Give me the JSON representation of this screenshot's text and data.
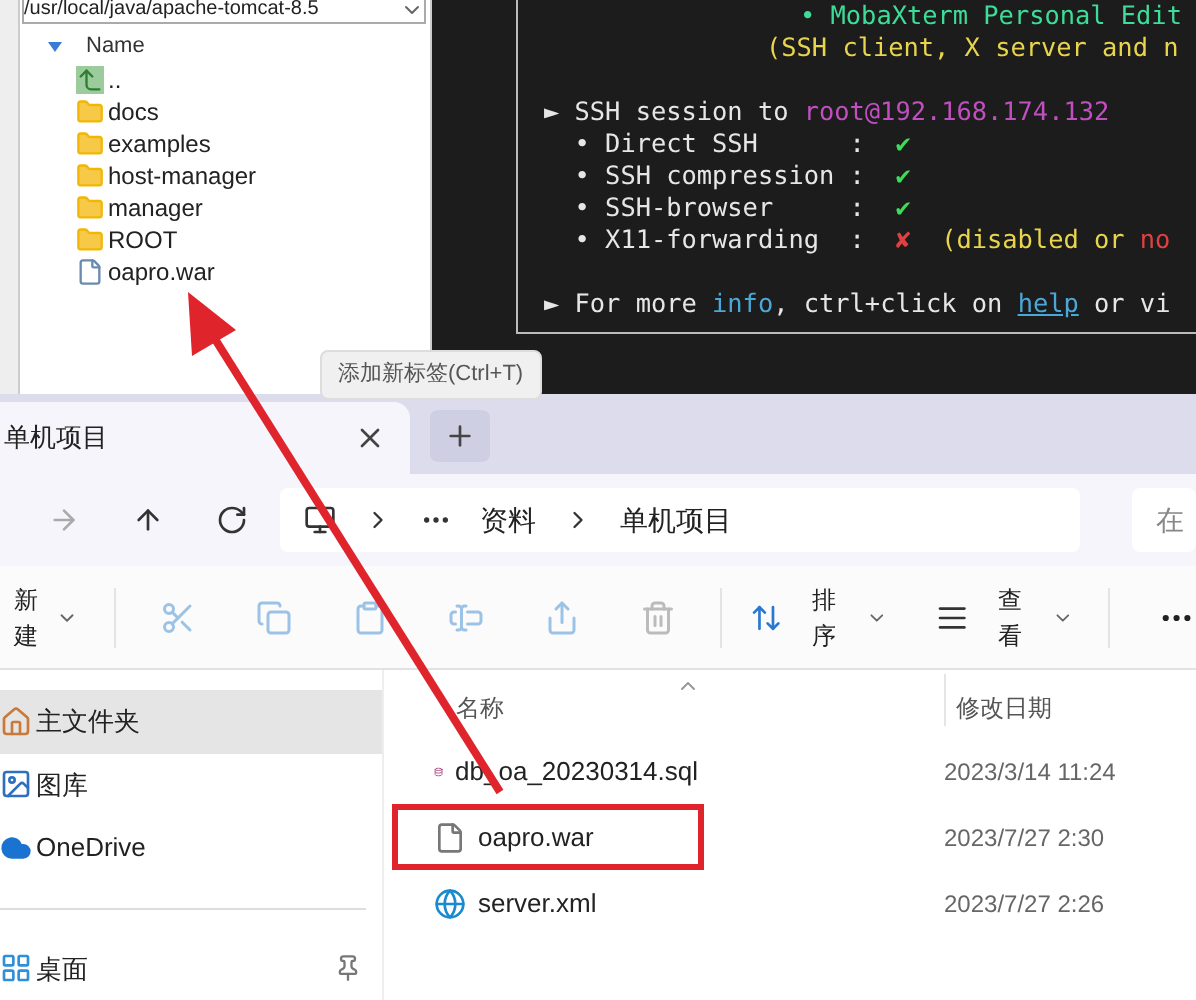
{
  "sftp_browser": {
    "path": "/usr/local/java/apache-tomcat-8.5",
    "column": "Name",
    "items": [
      {
        "kind": "up",
        "name": ".."
      },
      {
        "kind": "folder",
        "name": "docs"
      },
      {
        "kind": "folder",
        "name": "examples"
      },
      {
        "kind": "folder",
        "name": "host-manager"
      },
      {
        "kind": "folder",
        "name": "manager"
      },
      {
        "kind": "folder",
        "name": "ROOT"
      },
      {
        "kind": "file",
        "name": "oapro.war"
      }
    ]
  },
  "terminal": {
    "lines": [
      {
        "segments": [
          {
            "text": "• MobaXterm Personal Edit",
            "color": "#3ddc97"
          }
        ]
      },
      {
        "segments": [
          {
            "text": "(SSH client, X server and n",
            "color": "#e8d44d"
          }
        ]
      },
      {
        "segments": [
          {
            "text": "► SSH session to ",
            "color": "#e6e6e6"
          },
          {
            "text": "root@192.168.174.132",
            "color": "#c04fc0"
          }
        ]
      },
      {
        "segments": [
          {
            "text": "  • Direct SSH      :  ",
            "color": "#e6e6e6"
          },
          {
            "text": "✔",
            "color": "#3ddc5a"
          }
        ]
      },
      {
        "segments": [
          {
            "text": "  • SSH compression :  ",
            "color": "#e6e6e6"
          },
          {
            "text": "✔",
            "color": "#3ddc5a"
          }
        ]
      },
      {
        "segments": [
          {
            "text": "  • SSH-browser     :  ",
            "color": "#e6e6e6"
          },
          {
            "text": "✔",
            "color": "#3ddc5a"
          }
        ]
      },
      {
        "segments": [
          {
            "text": "  • X11-forwarding  :  ",
            "color": "#e6e6e6"
          },
          {
            "text": "✘",
            "color": "#e04040"
          },
          {
            "text": "  (disabled or ",
            "color": "#e8d44d"
          },
          {
            "text": "no",
            "color": "#e04040"
          }
        ]
      },
      {
        "segments": [
          {
            "text": "► For more ",
            "color": "#e6e6e6"
          },
          {
            "text": "info",
            "color": "#4aa8d8"
          },
          {
            "text": ", ctrl+click on ",
            "color": "#e6e6e6"
          },
          {
            "text": "help",
            "color": "#4aa8d8",
            "kind": "link"
          },
          {
            "text": " or vi",
            "color": "#e6e6e6"
          }
        ]
      }
    ]
  },
  "tooltip": "添加新标签(Ctrl+T)",
  "explorer": {
    "tabs": [
      {
        "label": "单机项目",
        "selected": true
      }
    ],
    "breadcrumb": [
      "资料",
      "单机项目"
    ],
    "search": {
      "placeholder": "在"
    },
    "toolbar": {
      "new": "新建",
      "sort": "排序",
      "view": "查看"
    },
    "sidebar": [
      {
        "label": "主文件夹",
        "kind": "home",
        "selected": true
      },
      {
        "label": "图库",
        "kind": "gallery",
        "selected": false
      },
      {
        "label": "OneDrive",
        "kind": "cloud",
        "selected": false
      },
      {
        "label": "桌面",
        "kind": "desktop",
        "selected": false,
        "pinned": true
      }
    ],
    "columns": [
      "名称",
      "修改日期"
    ],
    "files": [
      {
        "name": "db_oa_20230314.sql",
        "date": "2023/3/14 11:24",
        "kind": "database",
        "highlighted": false
      },
      {
        "name": "oapro.war",
        "date": "2023/7/27 2:30",
        "kind": "file",
        "highlighted": true
      },
      {
        "name": "server.xml",
        "date": "2023/7/27 2:26",
        "kind": "web",
        "highlighted": false
      }
    ]
  }
}
